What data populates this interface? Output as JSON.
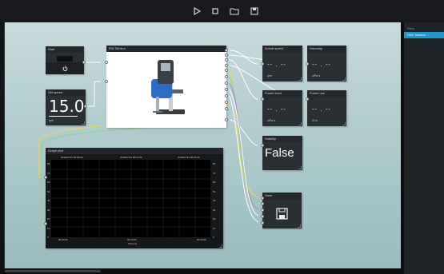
{
  "toolbar": {
    "icons": [
      "play-icon",
      "stop-icon",
      "open-folder-icon",
      "save-icon"
    ]
  },
  "right_panel": {
    "header": "Files",
    "selected_item": "SMV flowbox..."
  },
  "nodes": {
    "start": {
      "title": "Start"
    },
    "set_speed": {
      "title": "Set speed",
      "value": "15.0",
      "unit": "rpm"
    },
    "device": {
      "title": "RW Stirrers"
    },
    "actual_speed": {
      "title": "Actual speed",
      "value": "-- . --",
      "unit": "rpm"
    },
    "viscosity": {
      "title": "Viscosity",
      "value": "-- . --",
      "unit": "mPa·s"
    },
    "power_force": {
      "title": "Power force",
      "value": "-- . --",
      "unit": "mPa·s"
    },
    "power_use": {
      "title": "Power use",
      "value": "-- . --",
      "unit": "N·m"
    },
    "stability": {
      "title": "Stability",
      "value": "False"
    },
    "save": {
      "title": "Save"
    },
    "graph": {
      "title": "Graph plot",
      "header_left": "2016/07/31 08:00:00",
      "header_mid": "2016/07/31 08:10:00",
      "header_right": "2016/07/31 08:20:00",
      "y_left": [
        "80",
        "70",
        "60",
        "50",
        "40",
        "30",
        "20",
        "10",
        "0"
      ],
      "y_right": [
        "80",
        "70",
        "60",
        "50",
        "40",
        "30",
        "20",
        "10",
        "0"
      ],
      "x_left": "00:00:00",
      "x_mid": "00:10:00",
      "x_right": "00:20:00",
      "x_title": "Time (s)"
    }
  },
  "colors": {
    "canvas_top": "#c8dbdd",
    "canvas_bottom": "#9abcc0",
    "node_header": "#24282c",
    "node_body_dark": "#2a2f34",
    "accent_blue": "#2196c9",
    "wire_yellow": "#e5d36b",
    "wire_green": "#8fd28c",
    "wire_purple": "#a88ed8",
    "wire_white": "#ffffff"
  }
}
